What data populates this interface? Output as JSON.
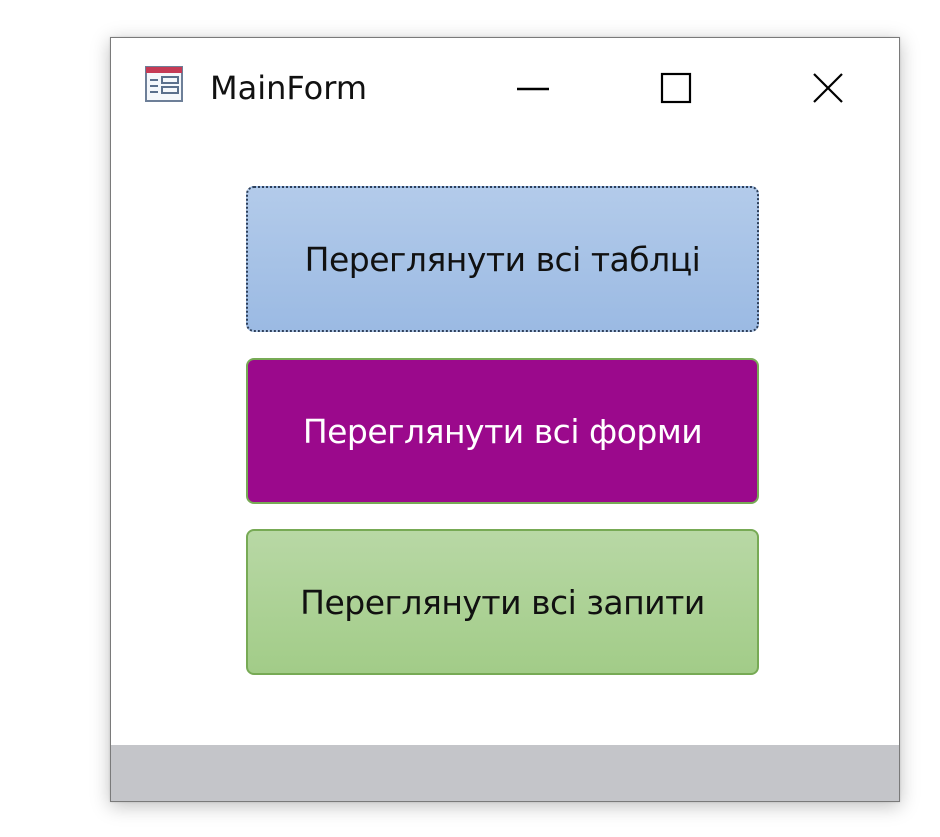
{
  "window": {
    "title": "MainForm",
    "icon": "form-icon",
    "controls": {
      "minimize_icon": "minimize-icon",
      "maximize_icon": "maximize-icon",
      "close_icon": "close-icon"
    }
  },
  "form": {
    "buttons": [
      {
        "label": "Переглянути всі таблці",
        "fill": "#9bbae3",
        "text_color": "#111111",
        "focused": true
      },
      {
        "label": "Переглянути всі форми",
        "fill": "#9b098c",
        "text_color": "#ffffff",
        "focused": false
      },
      {
        "label": "Переглянути всі запити",
        "fill": "#a2cc88",
        "text_color": "#111111",
        "focused": false
      }
    ]
  },
  "colors": {
    "statusbar": "#c4c5c9",
    "button_border_green": "#77aa55"
  }
}
